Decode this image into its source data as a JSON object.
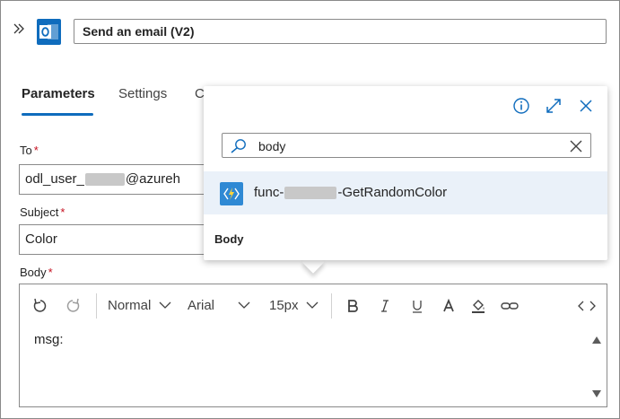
{
  "header": {
    "action_title": "Send an email (V2)"
  },
  "tabs": [
    {
      "label": "Parameters"
    },
    {
      "label": "Settings"
    },
    {
      "label": "C"
    }
  ],
  "fields": {
    "to": {
      "label": "To",
      "required_mark": "*",
      "value_start": "odl_user_",
      "value_end": "@azureh"
    },
    "subject": {
      "label": "Subject",
      "required_mark": "*",
      "value": "Color"
    },
    "body": {
      "label": "Body",
      "required_mark": "*"
    }
  },
  "editor": {
    "style": "Normal",
    "font": "Arial",
    "size": "15px",
    "content": "msg:"
  },
  "popup": {
    "search_value": "body",
    "result_prefix": "func-",
    "result_suffix": "-GetRandomColor",
    "section_label": "Body"
  },
  "colors": {
    "accent": "#0f6cbd",
    "required": "#c50f1f",
    "result_highlight": "#eaf1f9",
    "function_icon": "#2f89d4"
  }
}
